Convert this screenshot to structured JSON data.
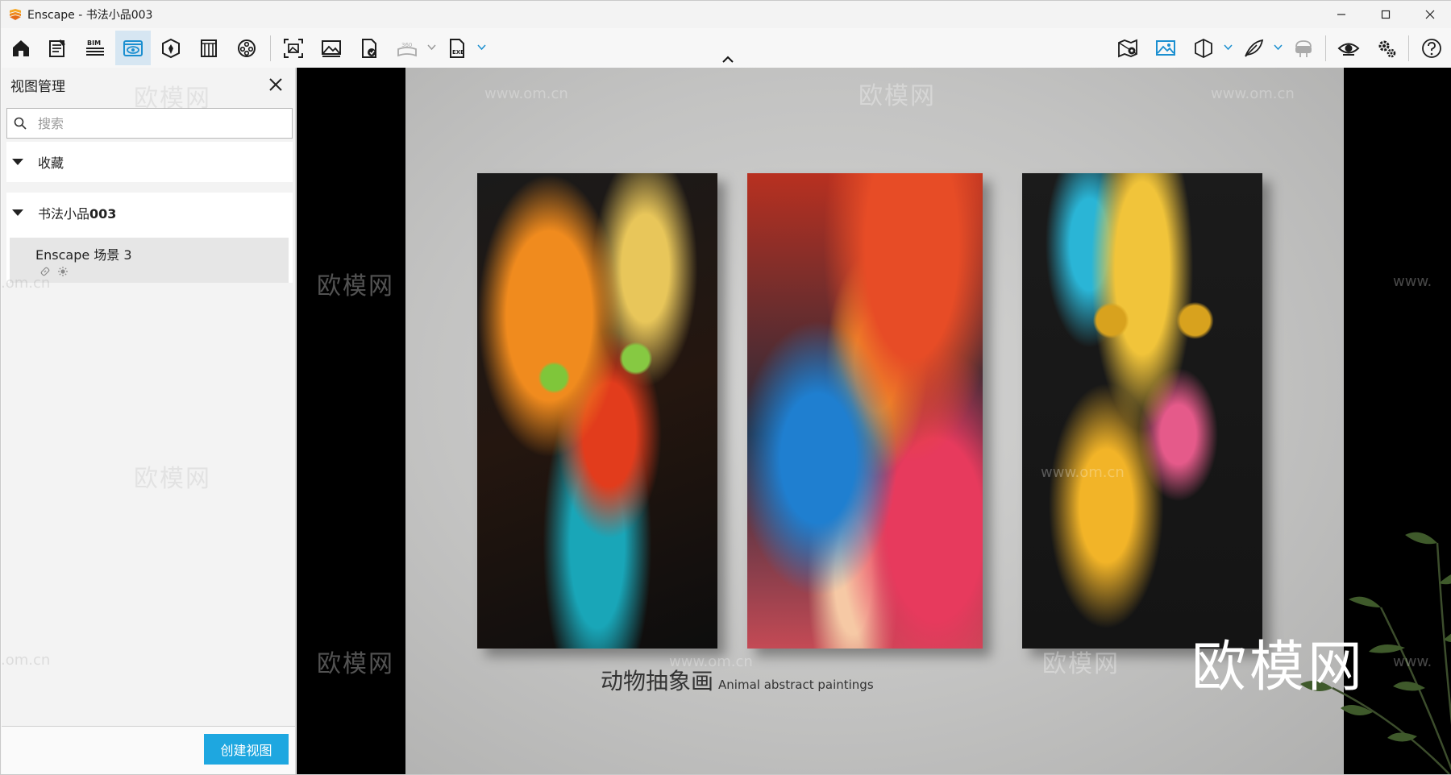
{
  "window": {
    "title": "Enscape - 书法小品003",
    "app_icon": "enscape-logo-icon",
    "accent_color": "#1ea7e0"
  },
  "toolbar": {
    "items": [
      {
        "icon": "home-icon"
      },
      {
        "icon": "notes-icon"
      },
      {
        "icon": "bim-icon",
        "label": "BIM"
      },
      {
        "icon": "view-management-icon",
        "active": true
      },
      {
        "icon": "asset-library-icon"
      },
      {
        "icon": "material-editor-icon"
      },
      {
        "icon": "video-editor-icon"
      },
      {
        "icon": "batch-render-icon"
      },
      {
        "icon": "screenshot-icon"
      },
      {
        "icon": "web-standalone-icon"
      },
      {
        "icon": "panorama-360-icon",
        "label": "360",
        "disabled": true
      },
      {
        "icon": "export-exe-icon",
        "label": "EXE"
      },
      {
        "icon": "map-pin-icon"
      },
      {
        "icon": "visual-settings-icon"
      },
      {
        "icon": "section-view-icon"
      },
      {
        "icon": "feather-icon"
      },
      {
        "icon": "vr-headset-icon",
        "disabled": true
      },
      {
        "icon": "eye-icon"
      },
      {
        "icon": "settings-icon"
      },
      {
        "icon": "help-icon"
      }
    ]
  },
  "panel": {
    "title": "视图管理",
    "search_placeholder": "搜索",
    "favorites_label": "收藏",
    "project_label_prefix": "书法小品",
    "project_label_number": "003",
    "view_item_name": "Enscape 场景 3",
    "create_view_label": "创建视图"
  },
  "viewport": {
    "caption_cn": "动物抽象画",
    "caption_en": "Animal abstract paintings",
    "watermark_cn": "欧模网",
    "watermark_url": "www.om.cn",
    "watermark_url_short": ".om.cn",
    "watermark_url_left": "www.",
    "big_watermark": "欧模网"
  }
}
